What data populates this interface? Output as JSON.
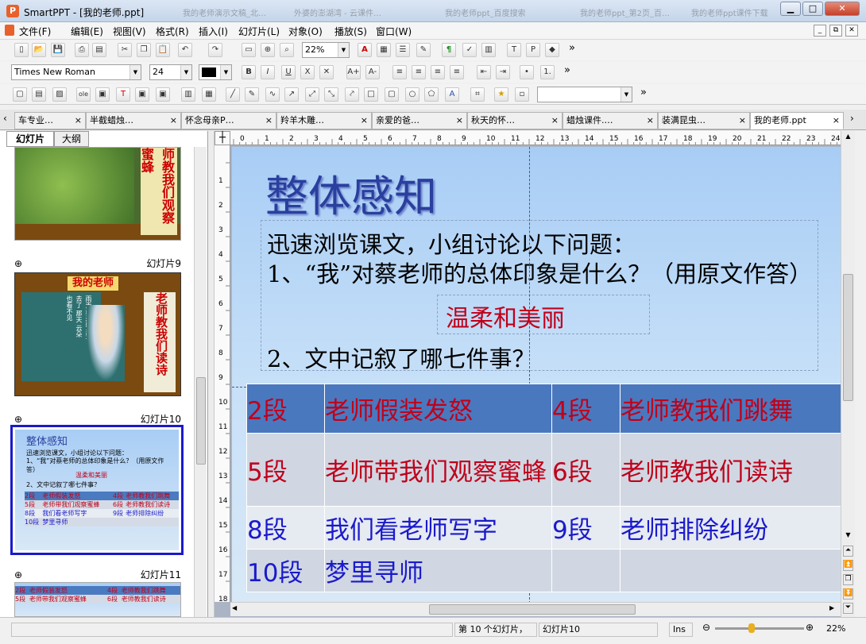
{
  "window": {
    "title": "SmartPPT - [我的老师.ppt]",
    "app_icon": "P",
    "bg_titles": [
      "我的老师演示文稿_北…",
      "外婆的澎湖湾 - 云课件…",
      "我的老师ppt_百度搜索",
      "我的老师ppt_第2页_百…",
      "我的老师ppt课件下载"
    ]
  },
  "menu": [
    "文件(F)",
    "编辑(E)",
    "视图(V)",
    "格式(R)",
    "插入(I)",
    "幻灯片(L)",
    "对象(O)",
    "播放(S)",
    "窗口(W)"
  ],
  "toolbar": {
    "zoom": "22%",
    "font_name": "Times New Roman",
    "font_size": "24",
    "more": "»"
  },
  "tabs": [
    {
      "label": "车专业…",
      "close": "×"
    },
    {
      "label": "半截蜡烛…",
      "close": "×"
    },
    {
      "label": "怀念母亲P…",
      "close": "×"
    },
    {
      "label": "羚羊木雕…",
      "close": "×"
    },
    {
      "label": "亲爱的爸…",
      "close": "×"
    },
    {
      "label": "秋天的怀…",
      "close": "×"
    },
    {
      "label": "蜡烛课件.…",
      "close": "×"
    },
    {
      "label": "装满昆虫…",
      "close": "×"
    },
    {
      "label": "我的老师.ppt",
      "close": "×"
    }
  ],
  "panel": {
    "tabs": [
      "幻灯片",
      "大纲"
    ],
    "slide_labels": [
      "幻灯片9",
      "幻灯片10",
      "幻灯片11"
    ],
    "thumb8_text": "师教我们观察蜜蜂",
    "thumb9_header": "我的老师",
    "thumb9_side": "老师教我们读诗",
    "thumb9_poem": [
      "雨天最美丽",
      "燕子去了",
      "那天",
      "云朵",
      "也看不见"
    ]
  },
  "slide": {
    "title": "整体感知",
    "question_intro": "迅速浏览课文，小组讨论以下问题：",
    "q1": "1、“我”对蔡老师的总体印象是什么？（用原文作答）",
    "answer": "温柔和美丽",
    "q2": "2、文中记叙了哪七件事？",
    "table": [
      [
        "2段",
        "老师假装发怒",
        "4段",
        "老师教我们跳舞"
      ],
      [
        "5段",
        "老师带我们观察蜜蜂",
        "6段",
        "老师教我们读诗"
      ],
      [
        "8段",
        "我们看老师写字",
        "9段",
        "老师排除纠纷"
      ],
      [
        "10段",
        "梦里寻师",
        "",
        ""
      ]
    ]
  },
  "status": {
    "slide_pos": "第 10 个幻灯片，",
    "slide_name": "幻灯片10",
    "mode": "Ins",
    "zoom": "22%"
  },
  "colors": {
    "title_blue": "#2a3f9e",
    "red_text": "#c0001a",
    "blue_text": "#1a1acc"
  }
}
